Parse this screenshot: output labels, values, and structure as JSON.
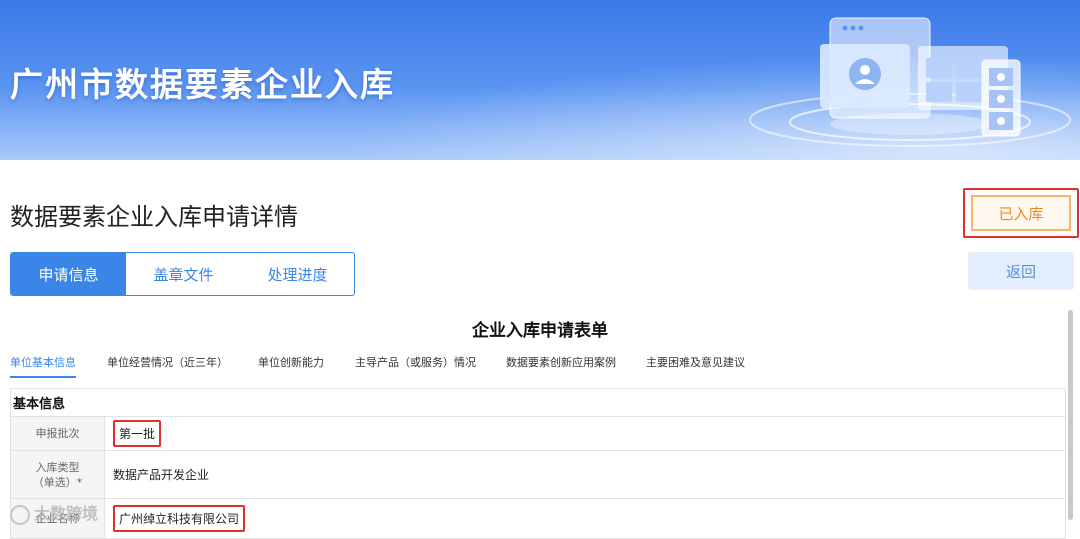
{
  "banner": {
    "title": "广州市数据要素企业入库"
  },
  "header": {
    "page_title": "数据要素企业入库申请详情",
    "status_label": "已入库",
    "back_label": "返回"
  },
  "tabs": [
    {
      "label": "申请信息",
      "active": true
    },
    {
      "label": "盖章文件",
      "active": false
    },
    {
      "label": "处理进度",
      "active": false
    }
  ],
  "form": {
    "title": "企业入库申请表单",
    "subtabs": [
      {
        "label": "单位基本信息",
        "active": true
      },
      {
        "label": "单位经营情况（近三年）",
        "active": false
      },
      {
        "label": "单位创新能力",
        "active": false
      },
      {
        "label": "主导产品（或服务）情况",
        "active": false
      },
      {
        "label": "数据要素创新应用案例",
        "active": false
      },
      {
        "label": "主要困难及意见建议",
        "active": false
      }
    ],
    "section": "基本信息",
    "rows": [
      {
        "label": "申报批次",
        "label2": "",
        "required": false,
        "value": "第一批"
      },
      {
        "label": "入库类型",
        "label2": "（单选）",
        "required": true,
        "required_mark": "*",
        "value": "数据产品开发企业"
      },
      {
        "label": "企业名称",
        "label2": "",
        "required": false,
        "value": "广州绰立科技有限公司"
      }
    ]
  },
  "watermark": {
    "text": "大数跨境"
  },
  "colors": {
    "primary": "#3a86e8",
    "highlight": "#e0302f",
    "status_orange": "#f08a23"
  }
}
